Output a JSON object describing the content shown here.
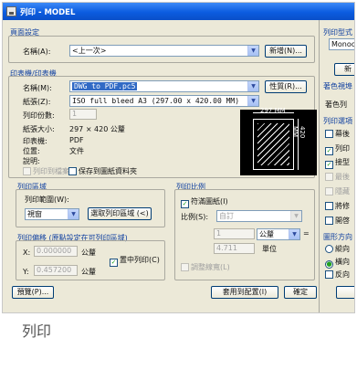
{
  "window": {
    "title": "列印 - MODEL"
  },
  "page_setup": {
    "section_title": "頁面設定",
    "name_label": "名稱(A):",
    "name_value": "<上一次>",
    "add_button": "新增(N)..."
  },
  "printer": {
    "section_title": "印表機/印表機",
    "name_label": "名稱(M):",
    "name_value": "DWG to PDF.pc5",
    "properties_button": "性質(R)...",
    "paper_label": "紙張(Z):",
    "paper_value": "ISO full bleed A3 (297.00 x 420.00 MM)",
    "copies_label": "列印份數:",
    "copies_value": "1",
    "paper_size_label": "紙張大小:",
    "paper_size_value": "297 × 420  公釐",
    "printer_label": "印表機:",
    "printer_value": "PDF",
    "location_label": "位置:",
    "location_value": "文件",
    "description_label": "說明:",
    "print_to_file": "列印到檔案",
    "save_layout": "保存到圖紙資料夾",
    "preview_width": "297 MM",
    "preview_height": "420 MM"
  },
  "print_area": {
    "section_title": "列印區域",
    "range_label": "列印範圍(W):",
    "range_value": "視窗",
    "select_button": "選取列印區域 (<)"
  },
  "print_offset": {
    "section_title": "列印偏移 (原點設定在可列印區域)",
    "x_label": "X:",
    "x_value": "0.000000",
    "x_unit": "公釐",
    "y_label": "Y:",
    "y_value": "0.457200",
    "y_unit": "公釐",
    "center_label": "置中列印(C)"
  },
  "print_scale": {
    "section_title": "列印比例",
    "fit_label": "符滿圖紙(I)",
    "scale_label": "比例(S):",
    "scale_value": "自訂",
    "num_value": "1",
    "unit_value": "公釐",
    "den_value": "4.711",
    "den_unit": "單位",
    "lineweight_label": "調整線寬(L)"
  },
  "footer": {
    "preview_button": "預覽(P)...",
    "apply_button": "套用到配置(I)",
    "ok_button": "確定"
  },
  "right_panel": {
    "style_title": "列印型式",
    "style_value": "Monoc",
    "new_button": "新",
    "shaded_title": "著色視埠",
    "shaded_label": "著色列",
    "options_title": "列印選項",
    "opt1": "幕後",
    "opt2": "列印",
    "opt3": "接型",
    "opt4": "最後",
    "opt5": "隱藏",
    "opt6": "將修",
    "opt7": "開啓",
    "orientation_title": "圖形方向",
    "orient1": "縱向",
    "orient2": "橫向",
    "orient3": "反向"
  },
  "caption": "列印"
}
